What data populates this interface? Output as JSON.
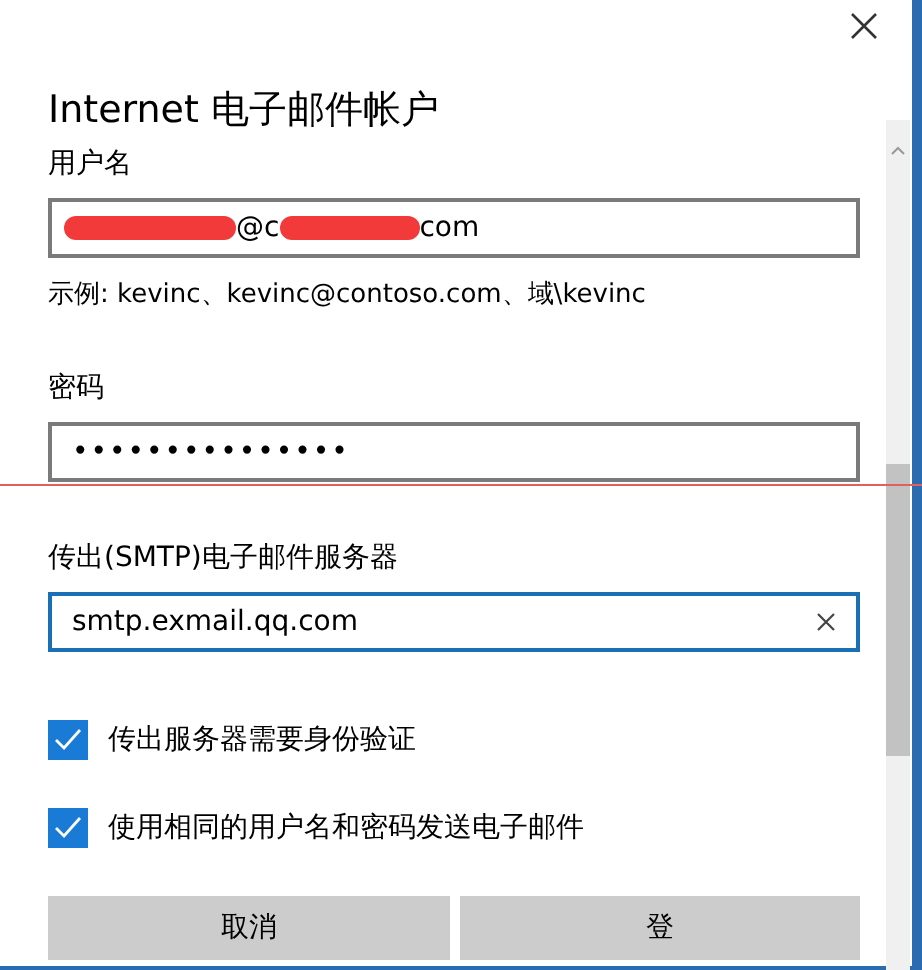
{
  "dialog": {
    "title": "Internet 电子邮件帐户"
  },
  "username": {
    "label": "用户名",
    "visible_parts": [
      "@c",
      "com"
    ],
    "hint": "示例: kevinc、kevinc@contoso.com、域\\kevinc"
  },
  "password": {
    "label": "密码",
    "value": "•••••••••••••••"
  },
  "smtp": {
    "label": "传出(SMTP)电子邮件服务器",
    "value": "smtp.exmail.qq.com",
    "focused": true
  },
  "options": [
    {
      "label": "传出服务器需要身份验证",
      "checked": true
    },
    {
      "label": "使用相同的用户名和密码发送电子邮件",
      "checked": true
    }
  ],
  "buttons": [
    "取消",
    "登"
  ]
}
